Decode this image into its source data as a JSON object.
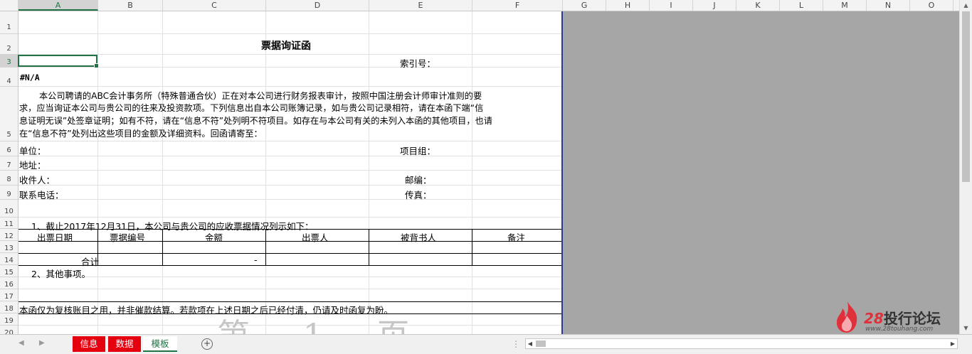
{
  "columns": [
    "A",
    "B",
    "C",
    "D",
    "E",
    "F",
    "G",
    "H",
    "I",
    "J",
    "K",
    "L",
    "M",
    "N",
    "O"
  ],
  "rows": [
    "1",
    "2",
    "3",
    "4",
    "5",
    "6",
    "7",
    "8",
    "9",
    "10",
    "11",
    "12",
    "13",
    "14",
    "15",
    "16",
    "17",
    "18",
    "19",
    "20"
  ],
  "doc": {
    "title": "票据询证函",
    "index_label": "索引号：",
    "error": "#N/A",
    "para_line1": "本公司聘请的ABC会计事务所（特殊普通合伙）正在对本公司进行财务报表审计，按照中国注册会计师审计准则的要",
    "para_line2": "求，应当询证本公司与贵公司的往来及投资款项。下列信息出自本公司账簿记录，如与贵公司记录相符，请在本函下端“信",
    "para_line3": "息证明无误”处签章证明；如有不符，请在“信息不符”处列明不符项目。如存在与本公司有关的未列入本函的其他项目，也请",
    "para_line4": "在“信息不符”处列出这些项目的金额及详细资料。回函请寄至：",
    "unit_label": "单位：",
    "project_group_label": "项目组：",
    "address_label": "地址：",
    "recipient_label": "收件人：",
    "postcode_label": "邮编：",
    "phone_label": "联系电话：",
    "fax_label": "传真：",
    "section1": "1、截止2017年12月31日，本公司与贵公司的应收票据情况列示如下：",
    "table_headers": [
      "出票日期",
      "票据编号",
      "金额",
      "出票人",
      "被背书人",
      "备注"
    ],
    "total_label": "合计",
    "total_amount": "-",
    "section2": "2、其他事项。",
    "footer_note": "本函仅为复核账目之用，并非催款结算。若款项在上述日期之后已经付清，仍请及时函复为盼。",
    "watermark": "第 1 页"
  },
  "tabs": [
    {
      "label": "信息",
      "style": "red"
    },
    {
      "label": "数据",
      "style": "red"
    },
    {
      "label": "模板",
      "style": "active"
    }
  ],
  "logo": {
    "number": "28",
    "text": "投行论坛",
    "url": "www.28touhang.com"
  },
  "colors": {
    "accent": "#217346",
    "tab_red": "#e6000f",
    "print_edge": "#2b3a8c",
    "outside_area": "#a6a6a6"
  }
}
